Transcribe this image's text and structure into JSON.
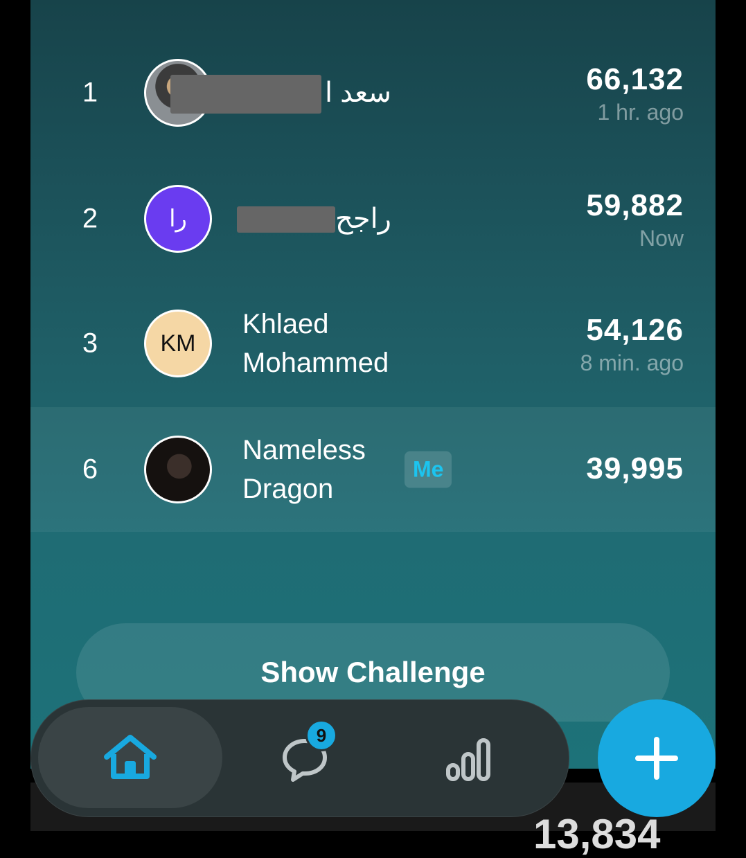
{
  "leaderboard": [
    {
      "rank": "1",
      "name": "سعد ا",
      "score": "66,132",
      "time": "1 hr. ago",
      "avatar": "photo"
    },
    {
      "rank": "2",
      "name": "راجح",
      "score": "59,882",
      "time": "Now",
      "avatar": "initials",
      "initials": "را"
    },
    {
      "rank": "3",
      "name": "Khlaed Mohammed",
      "score": "54,126",
      "time": "8 min. ago",
      "avatar": "initials",
      "initials": "KM"
    },
    {
      "rank": "6",
      "name": "Nameless Dragon",
      "score": "39,995",
      "time": "",
      "avatar": "photo",
      "me_label": "Me"
    }
  ],
  "show_challenge_label": "Show Challenge",
  "tabbar": {
    "messages_badge": "9"
  },
  "bottom_partial_number": "13,834",
  "colors": {
    "accent": "#18a9e0",
    "me_label": "#1cc4ef"
  }
}
